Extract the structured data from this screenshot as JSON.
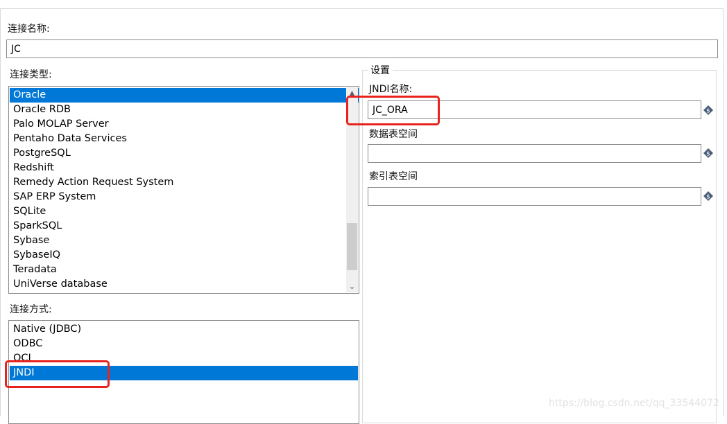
{
  "connection_name": {
    "label": "连接名称:",
    "value": "JC"
  },
  "connection_type": {
    "label": "连接类型:",
    "items": [
      "Oracle",
      "Oracle RDB",
      "Palo MOLAP Server",
      "Pentaho Data Services",
      "PostgreSQL",
      "Redshift",
      "Remedy Action Request System",
      "SAP ERP System",
      "SQLite",
      "SparkSQL",
      "Sybase",
      "SybaseIQ",
      "Teradata",
      "UniVerse database"
    ],
    "selected": "Oracle"
  },
  "access_method": {
    "label": "连接方式:",
    "items": [
      "Native (JDBC)",
      "ODBC",
      "OCI",
      "JNDI"
    ],
    "selected": "JNDI"
  },
  "settings": {
    "title": "设置",
    "jndi_name": {
      "label": "JNDI名称:",
      "value": "JC_ORA"
    },
    "tablespace": {
      "label": "数据表空间",
      "value": ""
    },
    "index_tablespace": {
      "label": "索引表空间",
      "value": ""
    }
  },
  "watermark": "https://blog.csdn.net/qq_33544072",
  "colors": {
    "selection": "#0078d7",
    "highlight_box": "#e8231e"
  },
  "icons": {
    "variable": "variable-diamond-icon"
  }
}
